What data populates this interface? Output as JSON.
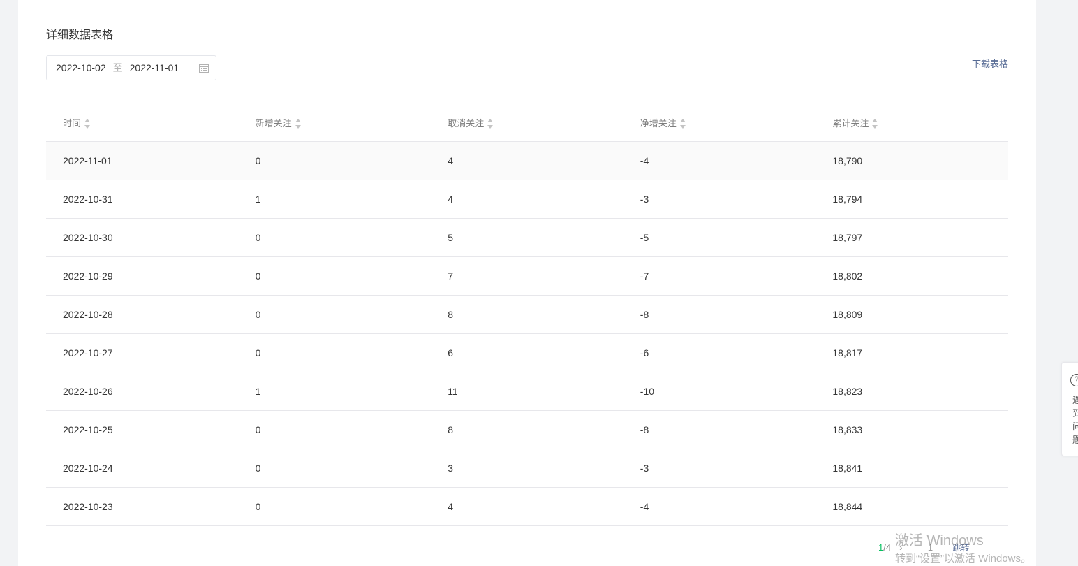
{
  "section_title": "详细数据表格",
  "date_range": {
    "start": "2022-10-02",
    "separator": "至",
    "end": "2022-11-01"
  },
  "download_label": "下载表格",
  "table": {
    "columns": [
      "时间",
      "新增关注",
      "取消关注",
      "净增关注",
      "累计关注"
    ],
    "rows": [
      [
        "2022-11-01",
        "0",
        "4",
        "-4",
        "18,790"
      ],
      [
        "2022-10-31",
        "1",
        "4",
        "-3",
        "18,794"
      ],
      [
        "2022-10-30",
        "0",
        "5",
        "-5",
        "18,797"
      ],
      [
        "2022-10-29",
        "0",
        "7",
        "-7",
        "18,802"
      ],
      [
        "2022-10-28",
        "0",
        "8",
        "-8",
        "18,809"
      ],
      [
        "2022-10-27",
        "0",
        "6",
        "-6",
        "18,817"
      ],
      [
        "2022-10-26",
        "1",
        "11",
        "-10",
        "18,823"
      ],
      [
        "2022-10-25",
        "0",
        "8",
        "-8",
        "18,833"
      ],
      [
        "2022-10-24",
        "0",
        "3",
        "-3",
        "18,841"
      ],
      [
        "2022-10-23",
        "0",
        "4",
        "-4",
        "18,844"
      ]
    ]
  },
  "pagination": {
    "current": "1",
    "total": "4",
    "next_icon": "chevron-right-icon",
    "jump_value": "1",
    "jump_label": "跳转"
  },
  "watermark": {
    "line1": "激活 Windows",
    "line2": "转到“设置”以激活 Windows。"
  },
  "side_help": {
    "icon": "question-icon",
    "text": "遇到问题"
  },
  "colors": {
    "accent": "#07c160",
    "link": "#576b95",
    "border": "#e7e7eb"
  }
}
